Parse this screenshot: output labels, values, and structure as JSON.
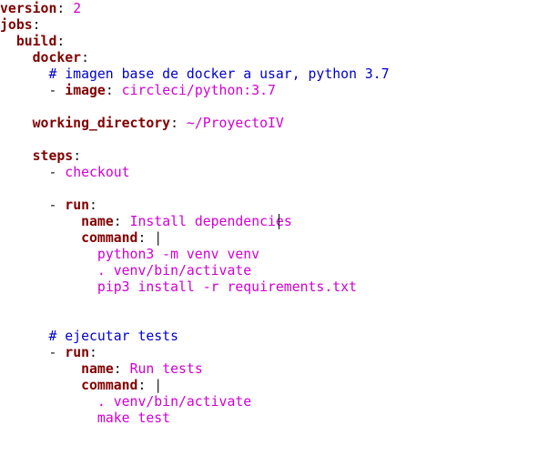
{
  "colors": {
    "background": "#ffffff",
    "key": "#800000",
    "string": "#d100d1",
    "comment": "#0000cc",
    "punct": "#1a1a1a"
  },
  "lines": [
    {
      "indent": "",
      "key": "version",
      "sep": ": ",
      "value": "2"
    },
    {
      "indent": "",
      "key": "jobs",
      "sep": ":"
    },
    {
      "indent": "  ",
      "key": "build",
      "sep": ":"
    },
    {
      "indent": "    ",
      "key": "docker",
      "sep": ":"
    },
    {
      "indent": "      ",
      "comment": "# imagen base de docker a usar, python 3.7"
    },
    {
      "indent": "      ",
      "dash": "- ",
      "key": "image",
      "sep": ": ",
      "value": "circleci/python:3.7"
    },
    {
      "blank": true
    },
    {
      "indent": "    ",
      "key": "working_directory",
      "sep": ": ",
      "value": "~/ProyectoIV"
    },
    {
      "blank": true
    },
    {
      "indent": "    ",
      "key": "steps",
      "sep": ":"
    },
    {
      "indent": "      ",
      "dash": "- ",
      "value": "checkout"
    },
    {
      "blank": true
    },
    {
      "indent": "      ",
      "dash": "- ",
      "key": "run",
      "sep": ":"
    },
    {
      "indent": "          ",
      "key": "name",
      "sep": ": ",
      "value": "Install dependencies"
    },
    {
      "indent": "          ",
      "key": "command",
      "sep": ": |"
    },
    {
      "indent": "            ",
      "value": "python3 -m venv venv"
    },
    {
      "indent": "            ",
      "value": ". venv/bin/activate"
    },
    {
      "indent": "            ",
      "value": "pip3 install -r requirements.txt"
    },
    {
      "blank": true
    },
    {
      "blank": true
    },
    {
      "indent": "      ",
      "comment": "# ejecutar tests"
    },
    {
      "indent": "      ",
      "dash": "- ",
      "key": "run",
      "sep": ":"
    },
    {
      "indent": "          ",
      "key": "name",
      "sep": ": ",
      "value": "Run tests"
    },
    {
      "indent": "          ",
      "key": "command",
      "sep": ": |"
    },
    {
      "indent": "            ",
      "value": ". venv/bin/activate"
    },
    {
      "indent": "            ",
      "value": "make test"
    }
  ]
}
